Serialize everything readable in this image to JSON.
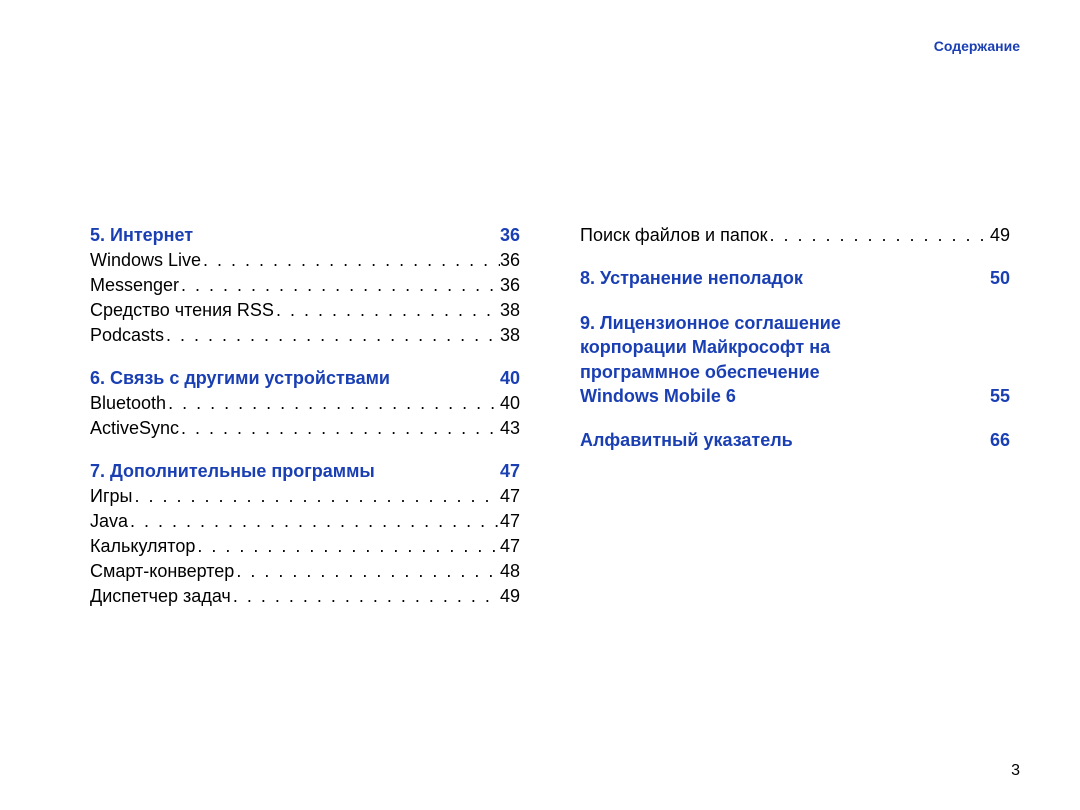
{
  "header": {
    "label": "Содержание"
  },
  "page_number": "3",
  "columns": {
    "left": [
      {
        "type": "chapter",
        "title": "5. Интернет",
        "page": "36",
        "first": true
      },
      {
        "type": "entry",
        "label": "Windows Live",
        "page": "36"
      },
      {
        "type": "entry",
        "label": "Messenger",
        "page": "36"
      },
      {
        "type": "entry",
        "label": "Средство чтения RSS",
        "page": "38"
      },
      {
        "type": "entry",
        "label": "Podcasts",
        "page": "38"
      },
      {
        "type": "chapter",
        "title": "6. Связь с другими устройствами",
        "page": "40"
      },
      {
        "type": "entry",
        "label": "Bluetooth",
        "page": "40"
      },
      {
        "type": "entry",
        "label": "ActiveSync",
        "page": "43"
      },
      {
        "type": "chapter",
        "title": "7. Дополнительные программы",
        "page": "47"
      },
      {
        "type": "entry",
        "label": "Игры",
        "page": "47"
      },
      {
        "type": "entry",
        "label": "Java",
        "page": "47"
      },
      {
        "type": "entry",
        "label": "Калькулятор",
        "page": "47"
      },
      {
        "type": "entry",
        "label": "Смарт-конвертер",
        "page": "48"
      },
      {
        "type": "entry",
        "label": "Диспетчер задач",
        "page": "49"
      }
    ],
    "right": [
      {
        "type": "entry",
        "label": "Поиск файлов и папок",
        "page": "49",
        "first": true
      },
      {
        "type": "chapter",
        "title": "8. Устранение неполадок",
        "page": "50"
      },
      {
        "type": "multichapter",
        "lines": [
          "9. Лицензионное соглашение",
          "корпорации Майкрософт на",
          "программное обеспечение"
        ],
        "last_line": "Windows Mobile 6",
        "page": "55"
      },
      {
        "type": "chapter",
        "title": "Алфавитный указатель",
        "page": "66"
      }
    ]
  }
}
